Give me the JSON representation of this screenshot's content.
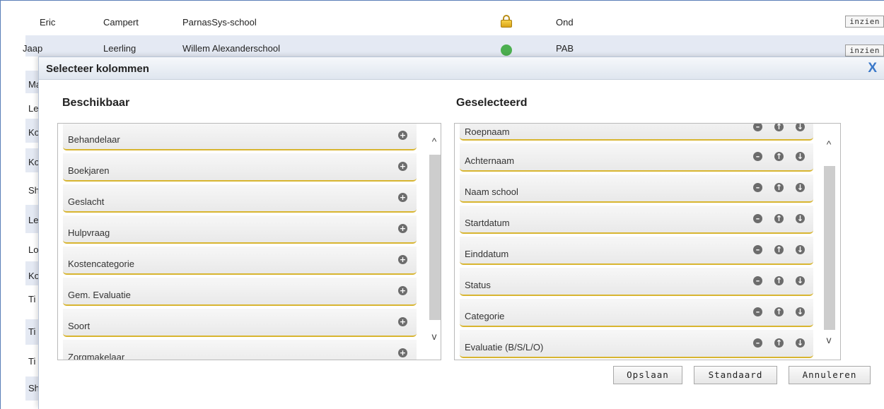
{
  "background": {
    "rows": [
      {
        "first": "Eric",
        "last": "Campert",
        "school": "ParnasSys-school",
        "icon": "lock-icon",
        "code": "Ond",
        "button": "inzien"
      },
      {
        "first": "Jaap",
        "last": "Leerling",
        "school": "Willem Alexanderschool",
        "icon": "status-dot-icon",
        "code": "PAB",
        "button": "inzien"
      }
    ],
    "left_fragments": [
      "Ma",
      "Le",
      "Ko",
      "Ko",
      "Sh",
      "Le",
      "Lo",
      "Ko",
      "Ti",
      "Ti",
      "Ti",
      "Sh"
    ]
  },
  "modal": {
    "title": "Selecteer kolommen",
    "close": "X",
    "available": {
      "title": "Beschikbaar",
      "items": [
        "Behandelaar",
        "Boekjaren",
        "Geslacht",
        "Hulpvraag",
        "Kostencategorie",
        "Gem. Evaluatie",
        "Soort",
        "Zorgmakelaar"
      ]
    },
    "selected": {
      "title": "Geselecteerd",
      "items": [
        "Roepnaam",
        "Achternaam",
        "Naam school",
        "Startdatum",
        "Einddatum",
        "Status",
        "Categorie",
        "Evaluatie (B/S/L/O)"
      ]
    },
    "buttons": {
      "save": "Opslaan",
      "default": "Standaard",
      "cancel": "Annuleren"
    },
    "icons": {
      "add": "+",
      "remove": "–",
      "up": "↑",
      "down": "↓",
      "scroll_up": "^",
      "scroll_down": "v"
    }
  }
}
